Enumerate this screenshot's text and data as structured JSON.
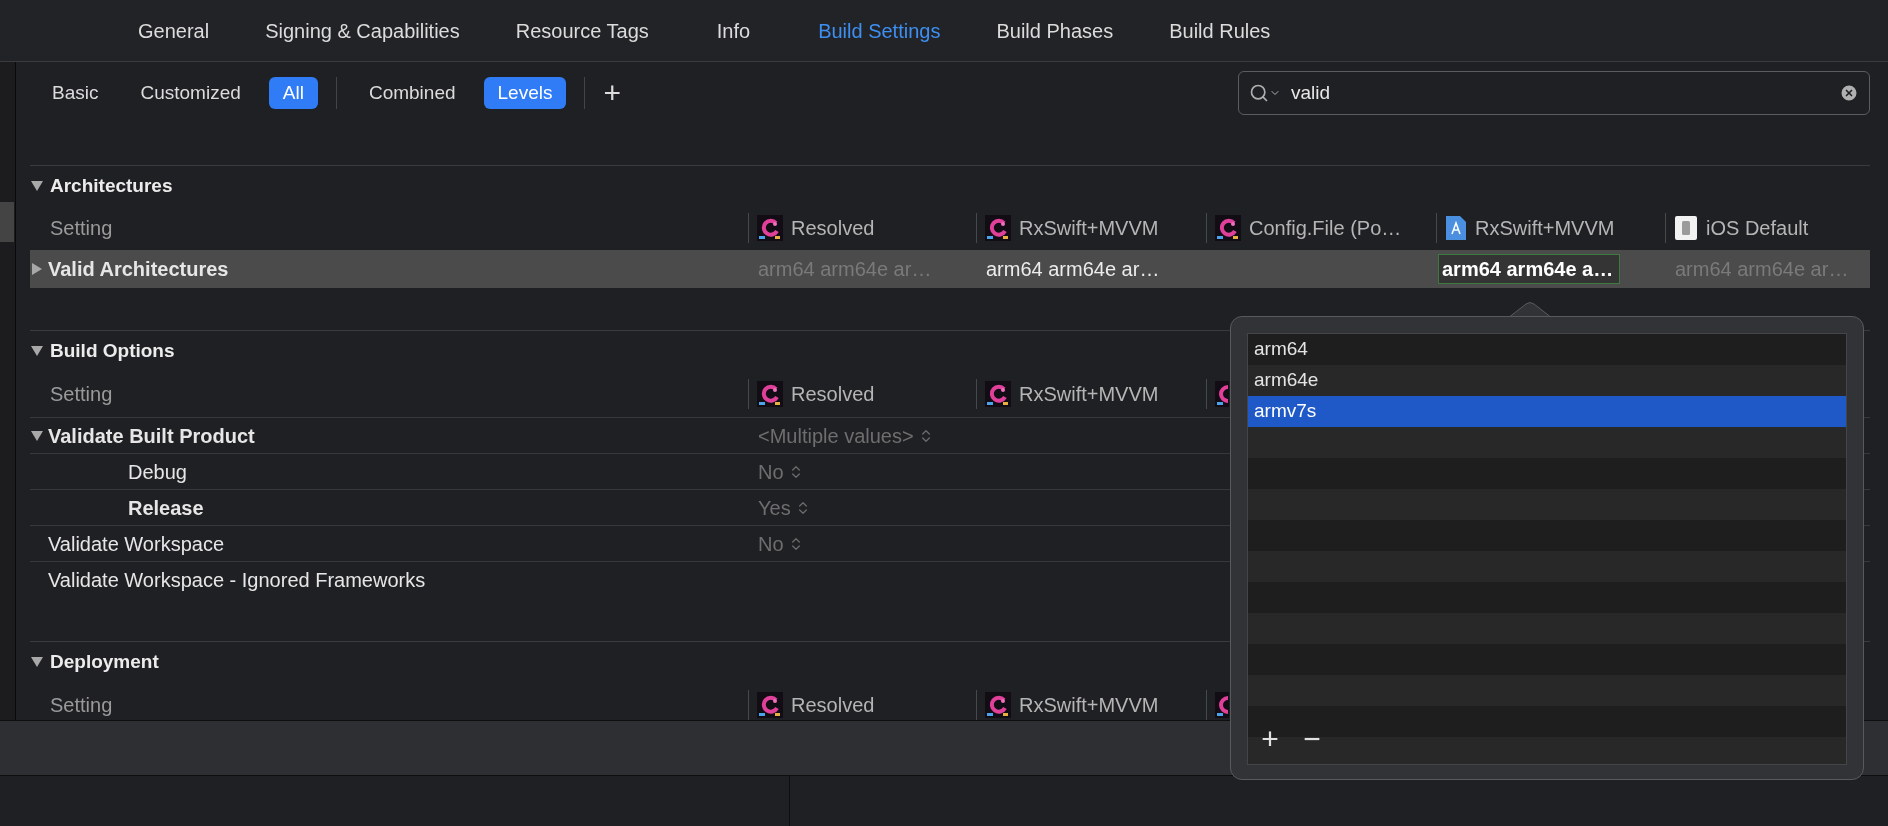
{
  "tabs": [
    {
      "label": "General",
      "selected": false
    },
    {
      "label": "Signing & Capabilities",
      "selected": false
    },
    {
      "label": "Resource Tags",
      "selected": false
    },
    {
      "label": "Info",
      "selected": false
    },
    {
      "label": "Build Settings",
      "selected": true
    },
    {
      "label": "Build Phases",
      "selected": false
    },
    {
      "label": "Build Rules",
      "selected": false
    }
  ],
  "filters": [
    [
      {
        "label": "Basic",
        "selected": false
      },
      {
        "label": "Customized",
        "selected": false
      },
      {
        "label": "All",
        "selected": true
      }
    ],
    [
      {
        "label": "Combined",
        "selected": false
      },
      {
        "label": "Levels",
        "selected": true
      }
    ]
  ],
  "add_button": "+",
  "search": {
    "value": "valid"
  },
  "sections": [
    {
      "title": "Architectures",
      "expanded": true,
      "setting_label": "Setting",
      "columns": [
        {
          "kind": "app",
          "label": "Resolved"
        },
        {
          "kind": "app",
          "label": "RxSwift+MVVM"
        },
        {
          "kind": "app",
          "label": "Config.File (Po…"
        },
        {
          "kind": "blueprint",
          "label": "RxSwift+MVVM"
        },
        {
          "kind": "device",
          "label": "iOS Default"
        }
      ],
      "rows": [
        {
          "name": "Valid Architectures",
          "bold": true,
          "expanded": false,
          "selected": true,
          "values": [
            {
              "text": "arm64 arm64e ar…",
              "kind": "inherited"
            },
            {
              "text": "arm64 arm64e ar…",
              "kind": "set"
            },
            {
              "kind": "empty"
            },
            {
              "text": "arm64 arm64e a…",
              "kind": "editing"
            },
            {
              "text": "arm64 arm64e ar…",
              "kind": "inherited"
            }
          ]
        }
      ]
    },
    {
      "title": "Build Options",
      "expanded": true,
      "setting_label": "Setting",
      "columns": [
        {
          "kind": "app",
          "label": "Resolved"
        },
        {
          "kind": "app",
          "label": "RxSwift+MVVM"
        },
        {
          "kind": "app-partial"
        }
      ],
      "rows": [
        {
          "name": "Validate Built Product",
          "bold": true,
          "expanded": true,
          "selected": false,
          "values": [
            {
              "text": "<Multiple values>",
              "kind": "popup"
            }
          ],
          "children": [
            {
              "name": "Debug",
              "bold": false,
              "selected": false,
              "values": [
                {
                  "text": "No",
                  "kind": "popup"
                }
              ]
            },
            {
              "name": "Release",
              "bold": true,
              "selected": false,
              "values": [
                {
                  "text": "Yes",
                  "kind": "popup"
                }
              ]
            }
          ]
        },
        {
          "name": "Validate Workspace",
          "bold": false,
          "selected": false,
          "values": [
            {
              "text": "No",
              "kind": "popup"
            }
          ]
        },
        {
          "name": "Validate Workspace - Ignored Frameworks",
          "bold": false,
          "selected": false,
          "values": []
        }
      ]
    },
    {
      "title": "Deployment",
      "expanded": true,
      "setting_label": "Setting",
      "columns": [
        {
          "kind": "app",
          "label": "Resolved"
        },
        {
          "kind": "app",
          "label": "RxSwift+MVVM"
        },
        {
          "kind": "app-partial"
        }
      ]
    }
  ],
  "popover": {
    "items": [
      {
        "label": "arm64",
        "selected": false
      },
      {
        "label": "arm64e",
        "selected": false
      },
      {
        "label": "armv7s",
        "selected": true
      }
    ],
    "add": "+",
    "remove": "−"
  }
}
